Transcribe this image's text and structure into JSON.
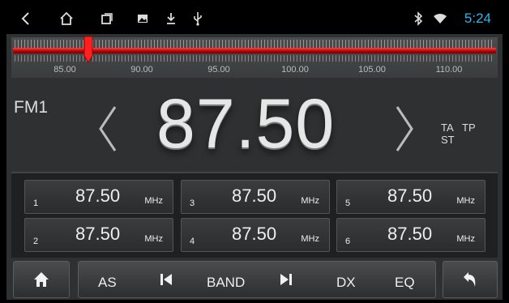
{
  "status_bar": {
    "icons": [
      "back-icon",
      "home-icon",
      "recent-apps-icon",
      "image-icon",
      "download-icon",
      "usb-icon",
      "bluetooth-icon",
      "wifi-icon"
    ],
    "time": "5:24",
    "time_color": "#2fb6e8"
  },
  "tuner": {
    "scale_labels": [
      "85.00",
      "90.00",
      "95.00",
      "100.00",
      "105.00",
      "110.00"
    ],
    "current_frequency_mhz": 87.5,
    "scale_min_mhz": 82.5,
    "scale_max_mhz": 114.0,
    "bar_color": "#e00000"
  },
  "main": {
    "band": "FM1",
    "frequency": "87.50",
    "flags": [
      "TA",
      "TP",
      "ST"
    ]
  },
  "presets": [
    {
      "number": "1",
      "frequency": "87.50",
      "unit": "MHz"
    },
    {
      "number": "3",
      "frequency": "87.50",
      "unit": "MHz"
    },
    {
      "number": "5",
      "frequency": "87.50",
      "unit": "MHz"
    },
    {
      "number": "2",
      "frequency": "87.50",
      "unit": "MHz"
    },
    {
      "number": "4",
      "frequency": "87.50",
      "unit": "MHz"
    },
    {
      "number": "6",
      "frequency": "87.50",
      "unit": "MHz"
    }
  ],
  "toolbar": {
    "as_label": "AS",
    "band_label": "BAND",
    "dx_label": "DX",
    "eq_label": "EQ"
  }
}
